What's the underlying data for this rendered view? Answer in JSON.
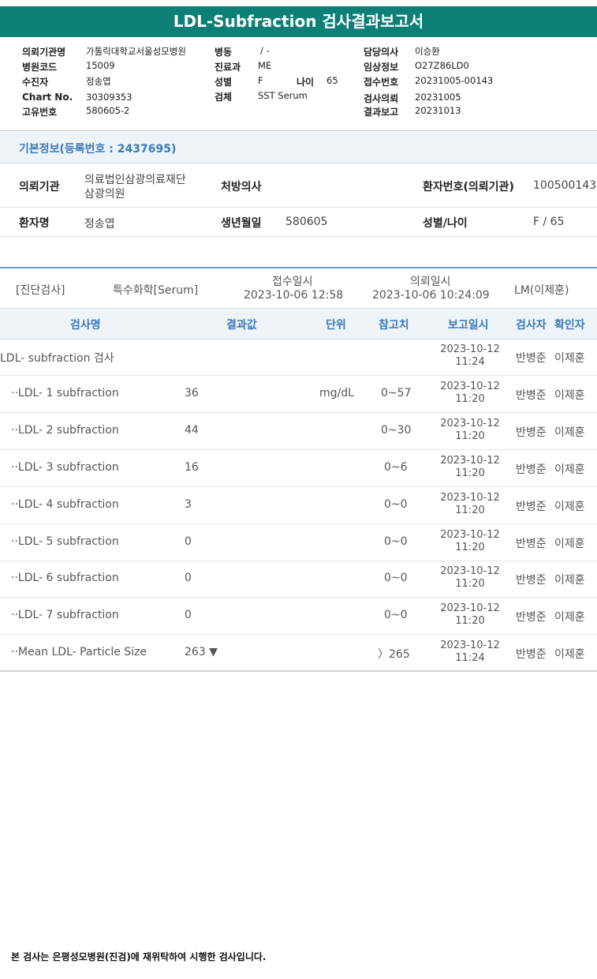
{
  "report_title": "LDL-Subfraction 검사결과보고서",
  "header": {
    "institution_label": "의뢰기관명",
    "institution": "가톨릭대학교서울성모병원",
    "hospital_code_label": "병원코드",
    "hospital_code": "15009",
    "patient_label": "수진자",
    "patient": "정송엽",
    "chart_label": "Chart No.",
    "chart": "30309353",
    "unique_label": "고유번호",
    "unique": "580605-2",
    "ward_label": "병동",
    "ward": "/ -",
    "dept_label": "진료과",
    "dept": "ME",
    "sex_label": "성별",
    "sex": "F",
    "age_label": "나이",
    "age": "65",
    "specimen_label": "검체",
    "specimen": "SST Serum",
    "doctor_label": "담당의사",
    "doctor": "이승환",
    "clinical_label": "임상정보",
    "clinical": "O27Z86LD0",
    "receipt_label": "접수번호",
    "receipt": "20231005-00143",
    "request_label": "검사의뢰",
    "request": "20231005",
    "result_label": "결과보고",
    "result": "20231013"
  },
  "basic": {
    "title": "기본정보(등록번호 : 2437695)",
    "inst_label": "의뢰기관",
    "inst_line1": "의료법인삼광의료재단",
    "inst_line2": "삼광의원",
    "prescriber_label": "처방의사",
    "patient_no_label": "환자번호(의뢰기관)",
    "patient_no": "100500143",
    "name_label": "환자명",
    "name": "정송엽",
    "birth_label": "생년월일",
    "birth": "580605",
    "sexage_label": "성별/나이",
    "sexage": "F / 65"
  },
  "meta": {
    "category": "[진단검사]",
    "subcategory": "특수화학[Serum]",
    "receipt_label": "접수일시",
    "receipt": "2023-10-06 12:58",
    "request_label": "의뢰일시",
    "request": "2023-10-06 10:24:09",
    "lm": "LM(이제훈)"
  },
  "columns": {
    "test": "검사명",
    "value": "결과값",
    "unit": "단위",
    "ref": "참고치",
    "report": "보고일시",
    "tester": "검사자",
    "confirmer": "확인자"
  },
  "rows": [
    {
      "name": "LDL- subfraction 검사",
      "value": "",
      "unit": "",
      "ref": "",
      "date": "2023-10-12",
      "time": "11:24",
      "tester": "반병준",
      "confirmer": "이제훈"
    },
    {
      "name": "··LDL- 1 subfraction",
      "value": "36",
      "unit": "mg/dL",
      "ref": "0~57",
      "date": "2023-10-12",
      "time": "11:20",
      "tester": "반병준",
      "confirmer": "이제훈"
    },
    {
      "name": "··LDL- 2 subfraction",
      "value": "44",
      "unit": "",
      "ref": "0~30",
      "date": "2023-10-12",
      "time": "11:20",
      "tester": "반병준",
      "confirmer": "이제훈"
    },
    {
      "name": "··LDL- 3 subfraction",
      "value": "16",
      "unit": "",
      "ref": "0~6",
      "date": "2023-10-12",
      "time": "11:20",
      "tester": "반병준",
      "confirmer": "이제훈"
    },
    {
      "name": "··LDL- 4 subfraction",
      "value": "3",
      "unit": "",
      "ref": "0~0",
      "date": "2023-10-12",
      "time": "11:20",
      "tester": "반병준",
      "confirmer": "이제훈"
    },
    {
      "name": "··LDL- 5 subfraction",
      "value": "0",
      "unit": "",
      "ref": "0~0",
      "date": "2023-10-12",
      "time": "11:20",
      "tester": "반병준",
      "confirmer": "이제훈"
    },
    {
      "name": "··LDL- 6 subfraction",
      "value": "0",
      "unit": "",
      "ref": "0~0",
      "date": "2023-10-12",
      "time": "11:20",
      "tester": "반병준",
      "confirmer": "이제훈"
    },
    {
      "name": "··LDL- 7 subfraction",
      "value": "0",
      "unit": "",
      "ref": "0~0",
      "date": "2023-10-12",
      "time": "11:20",
      "tester": "반병준",
      "confirmer": "이제훈"
    },
    {
      "name": "··Mean LDL- Particle Size",
      "value": "263 ▼",
      "unit": "",
      "ref": "〉265",
      "date": "2023-10-12",
      "time": "11:24",
      "tester": "반병준",
      "confirmer": "이제훈"
    }
  ],
  "footer": "본 검사는 은평성모병원(진검)에 재위탁하여 시행한 검사입니다."
}
